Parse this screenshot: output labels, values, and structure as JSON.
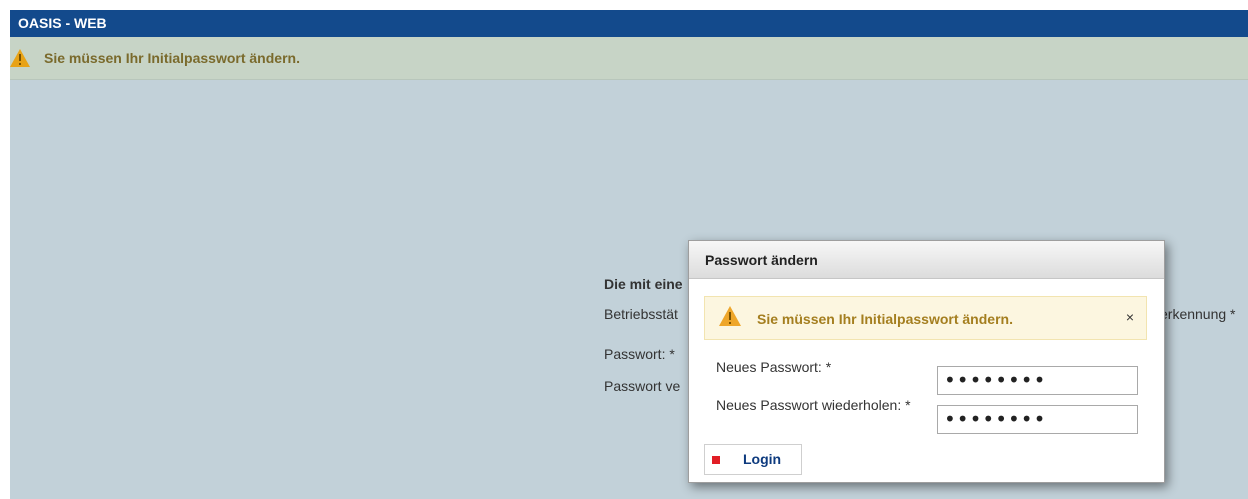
{
  "app": {
    "title": "OASIS - WEB"
  },
  "warning_bar": {
    "message": "Sie müssen Ihr Initialpasswort ändern."
  },
  "background_form": {
    "heading": "Die mit eine",
    "betriebsstaette_label": "Betriebsstät",
    "passwort_label": "Passwort:  *",
    "passwort_verify_label": "Passwort ve",
    "right_label": "erkennung  *"
  },
  "modal": {
    "title": "Passwort ändern",
    "alert": {
      "message": "Sie müssen Ihr Initialpasswort ändern.",
      "close": "×"
    },
    "fields": {
      "new_password": {
        "label": "Neues Passwort:  *",
        "value": "••••••••"
      },
      "repeat_password": {
        "label": "Neues Passwort wiederholen:  *",
        "value": "••••••••"
      }
    },
    "login_button": {
      "label": "Login"
    }
  },
  "colors": {
    "header": "#134a8c",
    "background": "#c2d1d9",
    "warning_text": "#a47e1f",
    "login_icon": "#e11e25"
  },
  "icons": {
    "warning": "warning-triangle-icon",
    "close": "close-icon",
    "login": "login-icon"
  }
}
